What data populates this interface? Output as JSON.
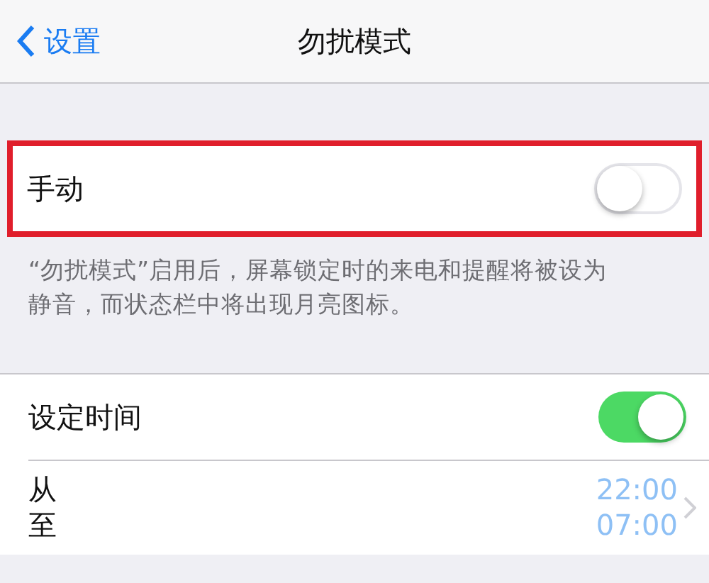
{
  "nav_bar": {
    "back_label": "设置",
    "title": "勿扰模式"
  },
  "manual": {
    "label": "手动",
    "on": false,
    "highlighted": true
  },
  "footer": "“勿扰模式”启用后，屏幕锁定时的来电和提醒将被设为静音，而状态栏中将出现月亮图标。",
  "scheduled": {
    "label": "设定时间",
    "on": true
  },
  "times": [
    {
      "label": "从",
      "time": "22:00"
    },
    {
      "label": "至",
      "time": "07:00"
    }
  ]
}
